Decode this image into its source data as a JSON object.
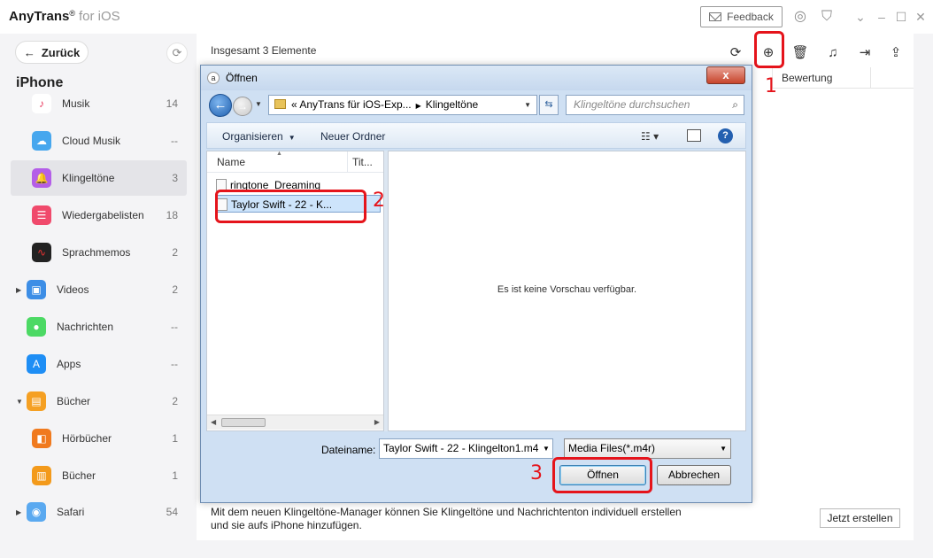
{
  "app": {
    "name": "AnyTrans",
    "reg": "®",
    "platform": "for iOS",
    "feedback_label": "Feedback"
  },
  "sidebar": {
    "back_label": "Zurück",
    "device": "iPhone",
    "items": [
      {
        "label": "Musik",
        "count": "14"
      },
      {
        "label": "Cloud Musik",
        "count": "--"
      },
      {
        "label": "Klingeltöne",
        "count": "3"
      },
      {
        "label": "Wiedergabelisten",
        "count": "18"
      },
      {
        "label": "Sprachmemos",
        "count": "2"
      },
      {
        "label": "Videos",
        "count": "2"
      },
      {
        "label": "Nachrichten",
        "count": "--"
      },
      {
        "label": "Apps",
        "count": "--"
      },
      {
        "label": "Bücher",
        "count": "2"
      },
      {
        "label": "Hörbücher",
        "count": "1"
      },
      {
        "label": "Bücher",
        "count": "1"
      },
      {
        "label": "Safari",
        "count": "54"
      }
    ]
  },
  "main": {
    "header": "Insgesamt 3 Elemente",
    "column_rating": "Bewertung",
    "footer_line1": "Mit dem neuen Klingeltöne-Manager können Sie Klingeltöne und Nachrichtenton individuell erstellen",
    "footer_line2": "und sie aufs iPhone hinzufügen.",
    "create_label": "Jetzt erstellen"
  },
  "dialog": {
    "title": "Öffnen",
    "close_glyph": "x",
    "path_prefix": "«",
    "path_folder": "AnyTrans für iOS-Exp...",
    "path_current": "Klingeltöne",
    "search_placeholder": "Klingeltöne durchsuchen",
    "organize_label": "Organisieren",
    "new_folder_label": "Neuer Ordner",
    "col_name": "Name",
    "col_title": "Tit...",
    "files": [
      {
        "name": "ringtone_Dreaming"
      },
      {
        "name": "Taylor Swift - 22 - K..."
      }
    ],
    "no_preview": "Es ist keine Vorschau verfügbar.",
    "filename_label": "Dateiname:",
    "filename_value": "Taylor Swift - 22 - Klingelton1.m4",
    "filter_value": "Media Files(*.m4r)",
    "open_label": "Öffnen",
    "cancel_label": "Abbrechen"
  },
  "callouts": {
    "one": "1",
    "two": "2",
    "three": "3"
  },
  "colors": {
    "accent": "#e5141b",
    "active_item": "#e4e4e8"
  }
}
